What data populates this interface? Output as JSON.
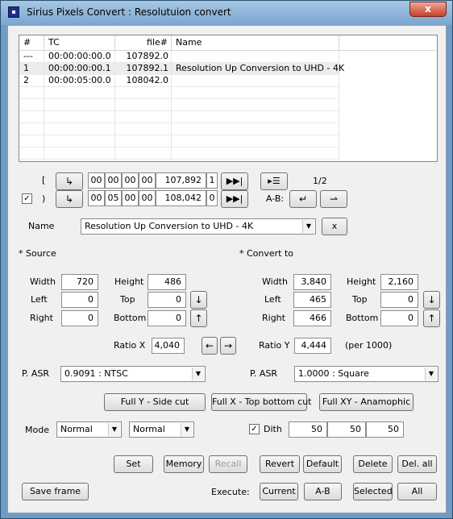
{
  "window": {
    "title": "Sirius Pixels Convert : Resolutuion convert",
    "close_label": "x"
  },
  "list": {
    "headers": [
      "#",
      "TC",
      "file#",
      "Name"
    ],
    "rows": [
      {
        "num": "---",
        "tc": "00:00:00:00.0",
        "file": "107892.0",
        "name": ""
      },
      {
        "num": "1",
        "tc": "00:00:00:00.1",
        "file": "107892.1",
        "name": "Resolution Up Conversion to UHD - 4K"
      },
      {
        "num": "2",
        "tc": "00:00:05:00.0",
        "file": "108042.0",
        "name": ""
      }
    ],
    "empty_row_count": 5
  },
  "timecode": {
    "in_bracket": "[",
    "out_bracket": ")",
    "in": {
      "hh": "00",
      "mm": "00",
      "ss": "00",
      "ff": "00",
      "frame": "107,892",
      "field": "1"
    },
    "out": {
      "hh": "00",
      "mm": "05",
      "ss": "00",
      "ff": "00",
      "frame": "108,042",
      "field": "0"
    },
    "out_checked": true,
    "page": "1/2",
    "ab_label": "A-B:"
  },
  "name_row": {
    "label": "Name",
    "value": "Resolution Up Conversion to UHD - 4K",
    "clear_label": "x"
  },
  "source": {
    "heading": "* Source",
    "width_label": "Width",
    "width": "720",
    "height_label": "Height",
    "height": "486",
    "left_label": "Left",
    "left": "0",
    "top_label": "Top",
    "top": "0",
    "right_label": "Right",
    "right": "0",
    "bottom_label": "Bottom",
    "bottom": "0"
  },
  "convert": {
    "heading": "* Convert to",
    "width_label": "Width",
    "width": "3,840",
    "height_label": "Height",
    "height": "2,160",
    "left_label": "Left",
    "left": "465",
    "top_label": "Top",
    "top": "0",
    "right_label": "Right",
    "right": "466",
    "bottom_label": "Bottom",
    "bottom": "0"
  },
  "ratio": {
    "x_label": "Ratio X",
    "x": "4,040",
    "y_label": "Ratio Y",
    "y": "4,444",
    "per": "(per 1000)"
  },
  "asr": {
    "label": "P. ASR",
    "source": "0.9091 : NTSC",
    "convert": "1.0000 : Square"
  },
  "fit_buttons": {
    "full_y": "Full Y - Side cut",
    "full_x": "Full X - Top bottom cut",
    "full_xy": "Full XY - Anamophic"
  },
  "mode": {
    "label": "Mode",
    "first": "Normal",
    "second": "Normal"
  },
  "dith": {
    "label": "Dith",
    "checked": true,
    "v1": "50",
    "v2": "50",
    "v3": "50"
  },
  "actions": {
    "set": "Set",
    "memory": "Memory",
    "recall": "Recall",
    "revert": "Revert",
    "default": "Default",
    "delete": "Delete",
    "del_all": "Del. all"
  },
  "bottom": {
    "save_frame": "Save frame",
    "execute_label": "Execute:",
    "current": "Current",
    "ab": "A-B",
    "selected": "Selected",
    "all": "All"
  }
}
